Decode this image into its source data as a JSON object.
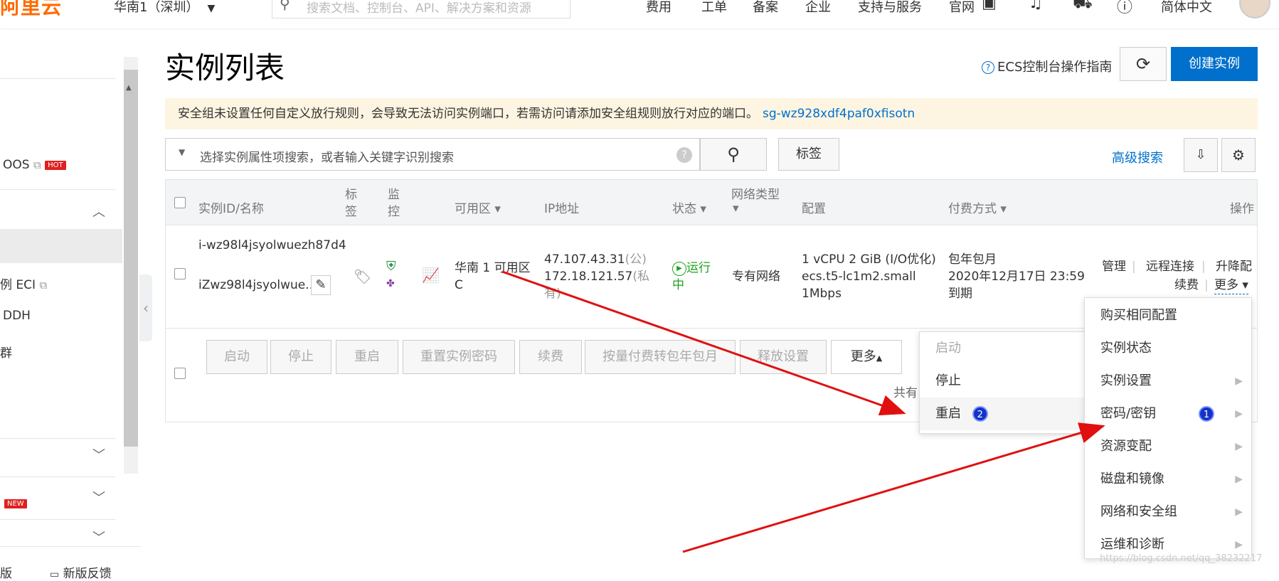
{
  "topbar": {
    "logo": "阿里云",
    "region": "华南1（深圳）",
    "search_placeholder": "搜索文档、控制台、API、解决方案和资源",
    "nav": [
      "费用",
      "工单",
      "备案",
      "企业",
      "支持与服务",
      "官网"
    ],
    "language": "简体中文"
  },
  "sidebar": {
    "items": [
      {
        "label": "OOS",
        "badge": "HOT"
      },
      {
        "label": "例 ECI"
      },
      {
        "label": "DDH"
      },
      {
        "label": "群"
      }
    ],
    "new_badge": "NEW",
    "footer_text": "新版反馈",
    "footer_left": "版"
  },
  "main": {
    "title": "实例列表",
    "guide_link": "ECS控制台操作指南",
    "create_button": "创建实例",
    "alert": {
      "text": "安全组未设置任何自定义放行规则，会导致无法访问实例端口，若需访问请添加安全组规则放行对应的端口。",
      "link": "sg-wz928xdf4paf0xfisotn"
    },
    "filter_placeholder": "选择实例属性项搜索，或者输入关键字识别搜索",
    "tag_button": "标签",
    "advanced_search": "高级搜索"
  },
  "table": {
    "headers": {
      "id": "实例ID/名称",
      "tag_1": "标",
      "tag_2": "签",
      "mon_1": "监",
      "mon_2": "控",
      "zone": "可用区",
      "ip": "IP地址",
      "status": "状态",
      "network": "网络类型",
      "config": "配置",
      "billing": "付费方式",
      "ops": "操作"
    },
    "row": {
      "instance_id": "i-wz98l4jsyolwuezh87d4",
      "name": "iZwz98l4jsyolwue...",
      "zone_1": "华南 1 可用区",
      "zone_2": "C",
      "ip_public": "47.107.43.31",
      "ip_public_suffix": "(公)",
      "ip_private": "172.18.121.57",
      "ip_private_suffix": "(私",
      "ip_private_suffix2": "有)",
      "status_1": "运行",
      "status_2": "中",
      "network": "专有网络",
      "config_1": "1 vCPU 2 GiB (I/O优化)",
      "config_2": "ecs.t5-lc1m2.small",
      "config_3": "1Mbps",
      "billing_1": "包年包月",
      "billing_2": "2020年12月17日 23:59",
      "billing_3": "到期",
      "ops": {
        "manage": "管理",
        "remote": "远程连接",
        "upgrade": "升降配",
        "renew": "续费",
        "more": "更多"
      }
    }
  },
  "batch_buttons": [
    "启动",
    "停止",
    "重启",
    "重置实例密码",
    "续费",
    "按量付费转包年包月",
    "释放设置"
  ],
  "batch_more": "更多",
  "total_text": "共有",
  "more_menu_left": {
    "items": [
      "启动",
      "停止",
      "重启"
    ],
    "marker": "2"
  },
  "more_menu_right": {
    "items": [
      "购买相同配置",
      "实例状态",
      "实例设置",
      "密码/密钥",
      "资源变配",
      "磁盘和镜像",
      "网络和安全组",
      "运维和诊断"
    ],
    "marker": "1"
  },
  "watermark": "https://blog.csdn.net/qq_38232217",
  "colors": {
    "accent": "#0070cc",
    "brand": "#ff6a00",
    "alert_bg": "#fdf5e1",
    "running": "#1fa31f",
    "arrow": "#e01010"
  }
}
